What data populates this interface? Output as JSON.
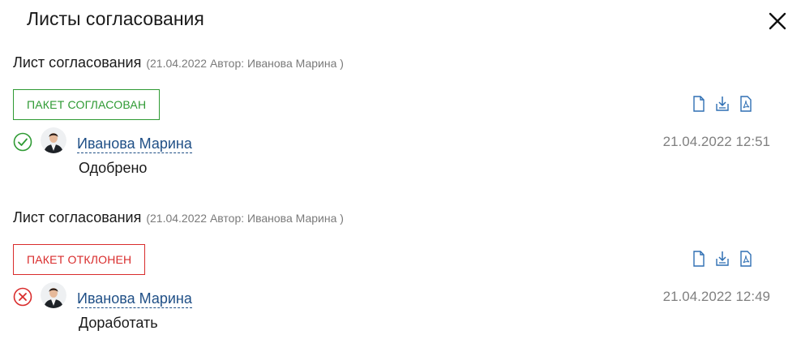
{
  "dialog": {
    "title": "Листы согласования",
    "close_icon": "close-icon"
  },
  "sheets": [
    {
      "title": "Лист согласования",
      "meta": "(21.04.2022 Автор: Иванова Марина )",
      "status": "ПАКЕТ СОГЛАСОВАН",
      "status_color": "#2e9a33",
      "state_icon": "check-circle-icon",
      "actions": [
        "document-icon",
        "download-icon",
        "pdf-icon"
      ],
      "approver": "Иванова Марина",
      "decision": "Одобрено",
      "timestamp": "21.04.2022 12:51"
    },
    {
      "title": "Лист согласования",
      "meta": "(21.04.2022 Автор: Иванова Марина )",
      "status": "ПАКЕТ ОТКЛОНЕН",
      "status_color": "#d92c2c",
      "state_icon": "cross-circle-icon",
      "actions": [
        "document-icon",
        "download-icon",
        "pdf-icon"
      ],
      "approver": "Иванова Марина",
      "decision": "Доработать",
      "timestamp": "21.04.2022 12:49"
    }
  ],
  "colors": {
    "link": "#1f4f86",
    "muted": "#808080"
  }
}
